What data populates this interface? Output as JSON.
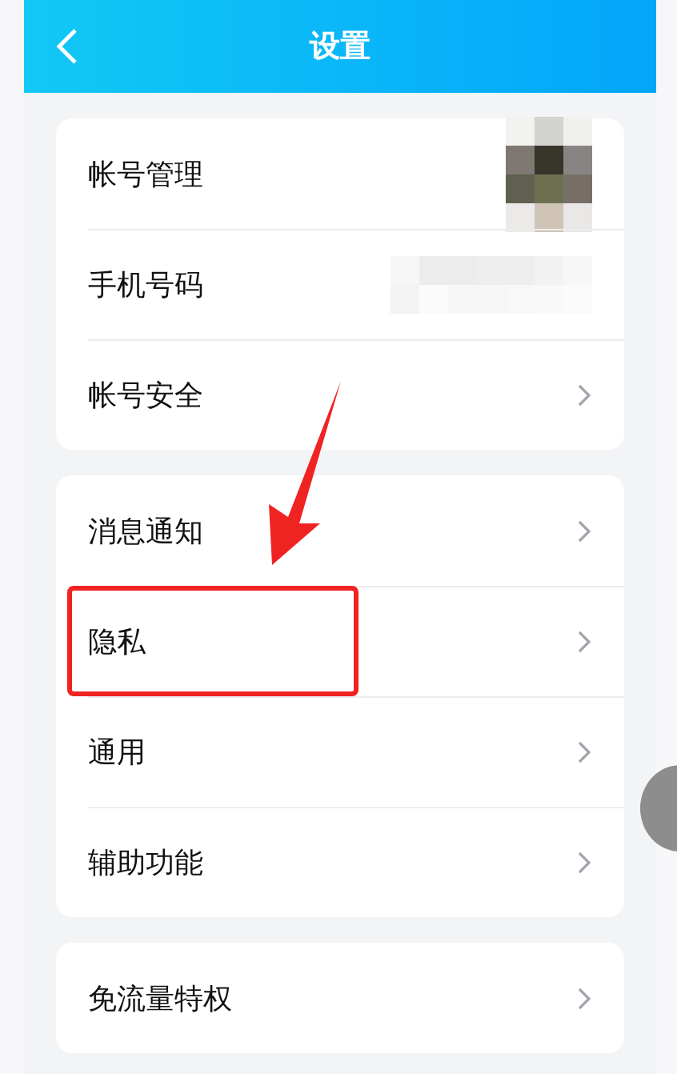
{
  "header": {
    "title": "设置"
  },
  "groups": [
    {
      "items": [
        {
          "label": "帐号管理",
          "kind": "avatar",
          "highlighted": false
        },
        {
          "label": "手机号码",
          "kind": "blurred",
          "highlighted": false
        },
        {
          "label": "帐号安全",
          "kind": "link",
          "highlighted": false
        }
      ]
    },
    {
      "items": [
        {
          "label": "消息通知",
          "kind": "link",
          "highlighted": false
        },
        {
          "label": "隐私",
          "kind": "link",
          "highlighted": true
        },
        {
          "label": "通用",
          "kind": "link",
          "highlighted": false
        },
        {
          "label": "辅助功能",
          "kind": "link",
          "highlighted": false
        }
      ]
    },
    {
      "items": [
        {
          "label": "免流量特权",
          "kind": "link",
          "highlighted": false
        }
      ]
    }
  ]
}
